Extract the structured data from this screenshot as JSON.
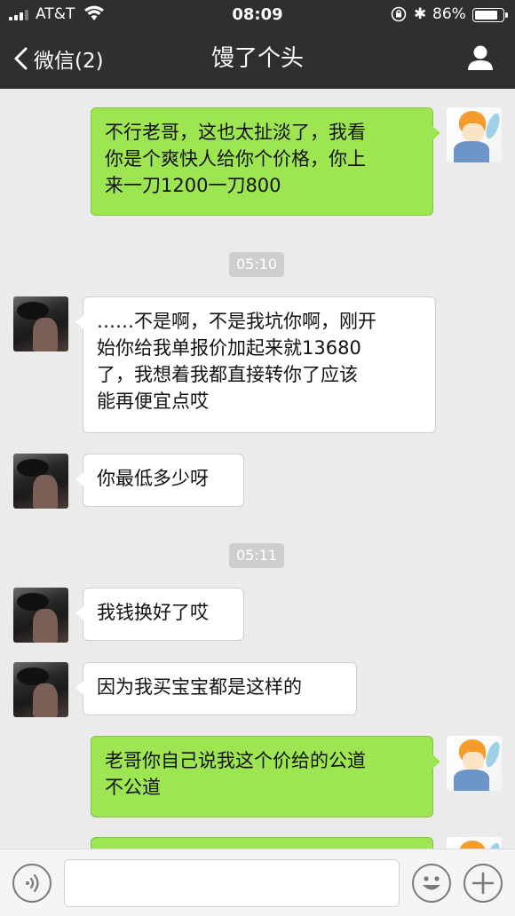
{
  "status_bar": {
    "carrier": "AT&T",
    "time": "08:09",
    "battery_percent": "86%",
    "battery_level": 0.86,
    "bluetooth_glyph": "✱"
  },
  "nav": {
    "back_label": "微信(2)",
    "title": "馒了个头",
    "profile_icon": "person-icon"
  },
  "messages": [
    {
      "side": "right",
      "text_lines": [
        "不行老哥，这也太扯淡了，我看",
        "你是个爽快人给你个价格，你上",
        "来一刀1200一刀800"
      ]
    },
    {
      "type": "timestamp",
      "text": "05:10"
    },
    {
      "side": "left",
      "text_lines": [
        "……不是啊，不是我坑你啊，刚开",
        "始你给我单报价加起来就13680",
        "了，我想着我都直接转你了应该",
        "能再便宜点哎"
      ]
    },
    {
      "side": "left",
      "text_lines": [
        "你最低多少呀"
      ]
    },
    {
      "type": "timestamp",
      "text": "05:11"
    },
    {
      "side": "left",
      "text_lines": [
        "我钱换好了哎"
      ]
    },
    {
      "side": "left",
      "text_lines": [
        "因为我买宝宝都是这样的"
      ]
    },
    {
      "side": "right",
      "text_lines": [
        "老哥你自己说我这个价给的公道",
        "不公道"
      ]
    }
  ],
  "input_bar": {
    "voice_icon": "voice-icon",
    "emoji_icon": "emoji-icon",
    "plus_icon": "plus-icon",
    "text_value": ""
  },
  "colors": {
    "nav_bg": "#2f2f31",
    "chat_bg": "#ebebeb",
    "my_bubble": "#9ee651",
    "their_bubble": "#ffffff",
    "timestamp_bg": "#cecece"
  }
}
